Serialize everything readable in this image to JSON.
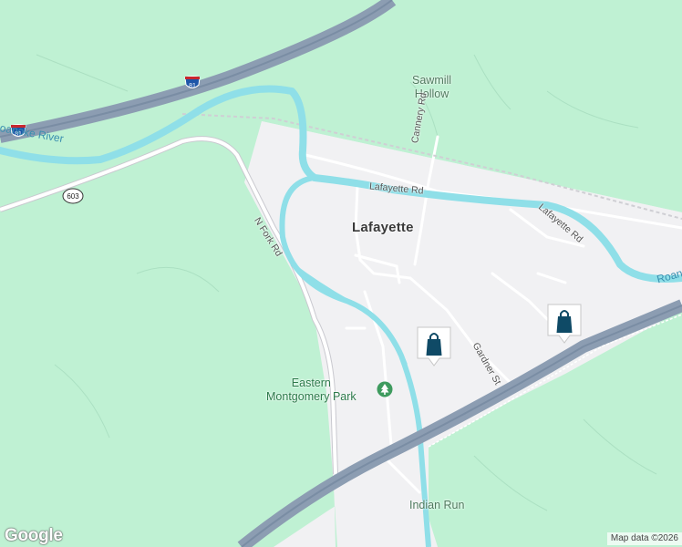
{
  "map": {
    "place_labels": {
      "town": "Lafayette",
      "sawmill_hollow_line1": "Sawmill",
      "sawmill_hollow_line2": "Hollow",
      "park_line1": "Eastern",
      "park_line2": "Montgomery Park",
      "indian_run": "Indian Run"
    },
    "water_labels": {
      "roanoke_river_left": "oanoke River",
      "roanoke_river_right": "Roano"
    },
    "road_labels": {
      "lafayette_rd_1": "Lafayette Rd",
      "lafayette_rd_2": "Lafayette Rd",
      "cannery_rd": "Cannery Rd",
      "n_fork_rd": "N Fork Rd",
      "gardner_st": "Gardner St"
    },
    "shields": {
      "interstate_top": "81",
      "interstate_left": "81",
      "state_route": "603"
    },
    "markers": [
      {
        "name": "shopping-marker-1",
        "icon": "shopping-bag-icon"
      },
      {
        "name": "shopping-marker-2",
        "icon": "shopping-bag-icon"
      }
    ],
    "park_icon": "tree-icon",
    "colors": {
      "land": "#f1f1f3",
      "forest": "#bff1d3",
      "water": "#8fdfe8",
      "highway": "#8c9db2",
      "marker": "#0f4a66"
    }
  },
  "footer": {
    "logo": "Google",
    "attribution": "Map data ©2026"
  }
}
